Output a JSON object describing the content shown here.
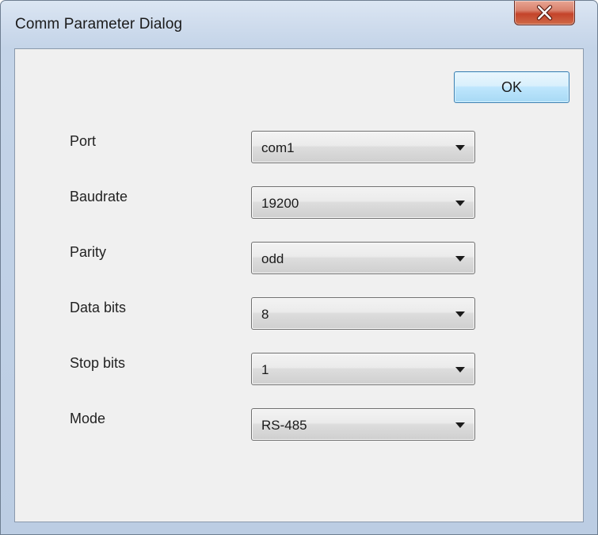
{
  "window": {
    "title": "Comm Parameter Dialog",
    "close_icon": "close-icon"
  },
  "buttons": {
    "ok_label": "OK"
  },
  "fields": [
    {
      "label": "Port",
      "value": "com1"
    },
    {
      "label": "Baudrate",
      "value": "19200"
    },
    {
      "label": "Parity",
      "value": "odd"
    },
    {
      "label": "Data bits",
      "value": "8"
    },
    {
      "label": "Stop bits",
      "value": "1"
    },
    {
      "label": "Mode",
      "value": "RS-485"
    }
  ]
}
